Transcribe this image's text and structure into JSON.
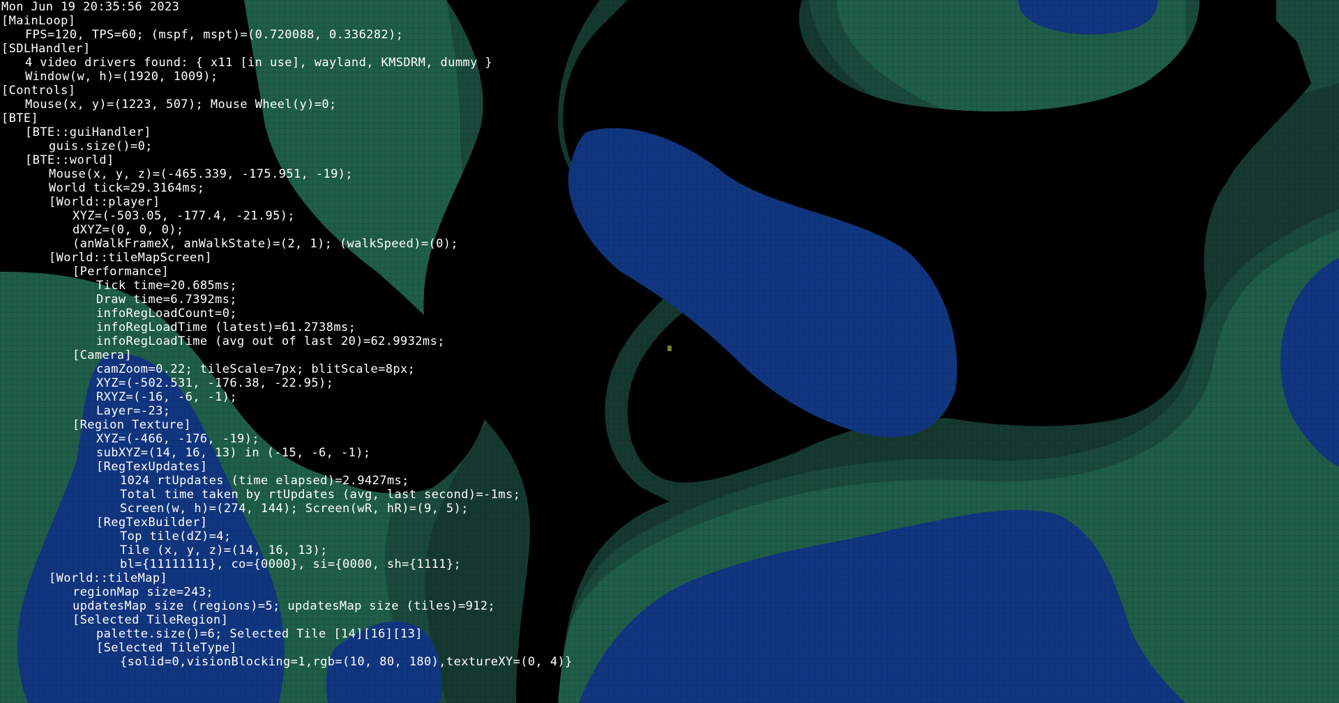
{
  "window": {
    "timestamp": "Mon Jun 19 20:35:56 2023"
  },
  "colors": {
    "void": "#000000",
    "terrain_light": "#1f5e48",
    "terrain_mid": "#1a4a3b",
    "terrain_dark": "#15392f",
    "water": "#113680",
    "water_deep": "#0f2f72",
    "debug_text": "#ffffff"
  },
  "debug_lines": [
    {
      "depth": 0,
      "text": "Mon Jun 19 20:35:56 2023"
    },
    {
      "depth": 0,
      "text": "[MainLoop]"
    },
    {
      "depth": 1,
      "text": "FPS=120, TPS=60; (mspf, mspt)=(0.720088, 0.336282);"
    },
    {
      "depth": 0,
      "text": "[SDLHandler]"
    },
    {
      "depth": 1,
      "text": "4 video drivers found: { x11 [in use], wayland, KMSDRM, dummy }"
    },
    {
      "depth": 1,
      "text": "Window(w, h)=(1920, 1009);"
    },
    {
      "depth": 0,
      "text": "[Controls]"
    },
    {
      "depth": 1,
      "text": "Mouse(x, y)=(1223, 507); Mouse Wheel(y)=0;"
    },
    {
      "depth": 0,
      "text": "[BTE]"
    },
    {
      "depth": 1,
      "text": "[BTE::guiHandler]"
    },
    {
      "depth": 2,
      "text": "guis.size()=0;"
    },
    {
      "depth": 1,
      "text": "[BTE::world]"
    },
    {
      "depth": 2,
      "text": "Mouse(x, y, z)=(-465.339, -175.951, -19);"
    },
    {
      "depth": 2,
      "text": "World tick=29.3164ms;"
    },
    {
      "depth": 2,
      "text": "[World::player]"
    },
    {
      "depth": 3,
      "text": "XYZ=(-503.05, -177.4, -21.95);"
    },
    {
      "depth": 3,
      "text": "dXYZ=(0, 0, 0);"
    },
    {
      "depth": 3,
      "text": "(anWalkFrameX, anWalkState)=(2, 1); (walkSpeed)=(0);"
    },
    {
      "depth": 2,
      "text": "[World::tileMapScreen]"
    },
    {
      "depth": 3,
      "text": "[Performance]"
    },
    {
      "depth": 4,
      "text": "Tick time=20.685ms;"
    },
    {
      "depth": 4,
      "text": "Draw time=6.7392ms;"
    },
    {
      "depth": 4,
      "text": "infoRegLoadCount=0;"
    },
    {
      "depth": 4,
      "text": "infoRegLoadTime (latest)=61.2738ms;"
    },
    {
      "depth": 4,
      "text": "infoRegLoadTime (avg out of last 20)=62.9932ms;"
    },
    {
      "depth": 3,
      "text": "[Camera]"
    },
    {
      "depth": 4,
      "text": "camZoom=0.22; tileScale=7px; blitScale=8px;"
    },
    {
      "depth": 4,
      "text": "XYZ=(-502.531, -176.38, -22.95);"
    },
    {
      "depth": 4,
      "text": "RXYZ=(-16, -6, -1);"
    },
    {
      "depth": 4,
      "text": "Layer=-23;"
    },
    {
      "depth": 3,
      "text": "[Region Texture]"
    },
    {
      "depth": 4,
      "text": "XYZ=(-466, -176, -19);"
    },
    {
      "depth": 4,
      "text": "subXYZ=(14, 16, 13) in (-15, -6, -1);"
    },
    {
      "depth": 4,
      "text": "[RegTexUpdates]"
    },
    {
      "depth": 5,
      "text": "1024 rtUpdates (time elapsed)=2.9427ms;"
    },
    {
      "depth": 5,
      "text": "Total time taken by rtUpdates (avg, last second)=-1ms;"
    },
    {
      "depth": 5,
      "text": "Screen(w, h)=(274, 144); Screen(wR, hR)=(9, 5);"
    },
    {
      "depth": 4,
      "text": "[RegTexBuilder]"
    },
    {
      "depth": 5,
      "text": "Top tile(dZ)=4;"
    },
    {
      "depth": 5,
      "text": "Tile (x, y, z)=(14, 16, 13);"
    },
    {
      "depth": 5,
      "text": "bl={11111111}, co={0000}, si={0000, sh={1111};"
    },
    {
      "depth": 2,
      "text": "[World::tileMap]"
    },
    {
      "depth": 3,
      "text": "regionMap size=243;"
    },
    {
      "depth": 3,
      "text": "updatesMap size (regions)=5; updatesMap size (tiles)=912;"
    },
    {
      "depth": 3,
      "text": "[Selected TileRegion]"
    },
    {
      "depth": 4,
      "text": "palette.size()=6; Selected Tile [14][16][13]"
    },
    {
      "depth": 4,
      "text": "[Selected TileType]"
    },
    {
      "depth": 5,
      "text": "{solid=0,visionBlocking=1,rgb=(10, 80, 180),textureXY=(0, 4)}"
    }
  ]
}
